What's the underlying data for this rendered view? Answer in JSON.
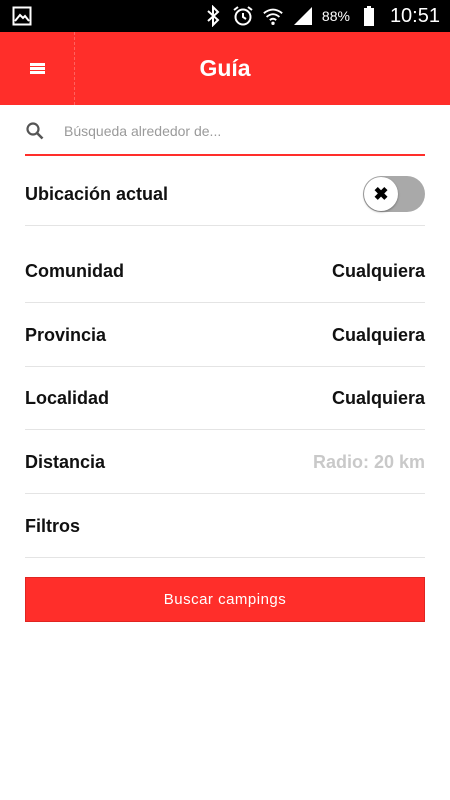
{
  "status_bar": {
    "battery_percent": "88%",
    "time": "10:51",
    "icons": [
      "image-icon",
      "bluetooth-icon",
      "alarm-icon",
      "wifi-icon",
      "signal-icon",
      "battery-icon"
    ]
  },
  "app_bar": {
    "title": "Guía",
    "menu_icon": "hamburger-menu-icon",
    "color": "#ff2e2a"
  },
  "search": {
    "placeholder": "Búsqueda alrededor de...",
    "value": ""
  },
  "location": {
    "label": "Ubicación actual",
    "toggle_state": "off"
  },
  "filters": [
    {
      "label": "Comunidad",
      "value": "Cualquiera"
    },
    {
      "label": "Provincia",
      "value": "Cualquiera"
    },
    {
      "label": "Localidad",
      "value": "Cualquiera"
    },
    {
      "label": "Distancia",
      "value": "Radio: 20 km"
    },
    {
      "label": "Filtros",
      "value": ""
    }
  ],
  "submit_label": "Buscar campings"
}
